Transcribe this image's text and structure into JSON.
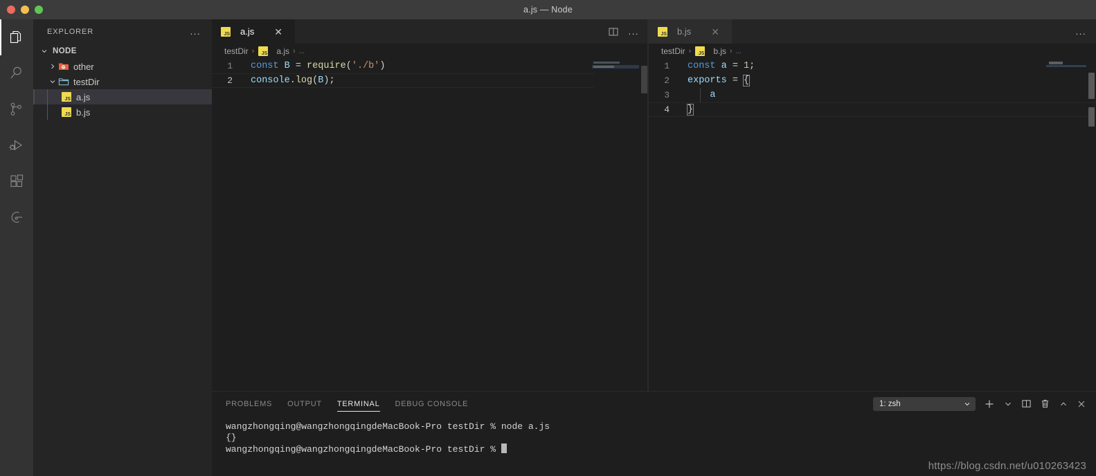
{
  "window": {
    "title": "a.js — Node",
    "traffic_lights": [
      "close",
      "minimize",
      "zoom"
    ]
  },
  "activity_bar": {
    "items": [
      {
        "name": "explorer",
        "icon": "files-icon",
        "active": true
      },
      {
        "name": "search",
        "icon": "search-icon",
        "active": false
      },
      {
        "name": "source-control",
        "icon": "source-control-icon",
        "active": false
      },
      {
        "name": "run-and-debug",
        "icon": "run-debug-icon",
        "active": false
      },
      {
        "name": "extensions",
        "icon": "extensions-icon",
        "active": false
      },
      {
        "name": "remote-explorer",
        "icon": "remote-icon",
        "active": false
      }
    ]
  },
  "sidebar": {
    "header": {
      "title": "EXPLORER",
      "more_actions": "..."
    },
    "root": {
      "label": "NODE",
      "expanded": true
    },
    "tree": [
      {
        "label": "other",
        "type": "folder",
        "icon": "folder-other-icon",
        "expanded": false,
        "depth": 1,
        "selected": false
      },
      {
        "label": "testDir",
        "type": "folder",
        "icon": "folder-open-icon",
        "expanded": true,
        "depth": 1,
        "selected": false
      },
      {
        "label": "a.js",
        "type": "file",
        "icon": "js-file-icon",
        "depth": 2,
        "selected": true
      },
      {
        "label": "b.js",
        "type": "file",
        "icon": "js-file-icon",
        "depth": 2,
        "selected": false
      }
    ]
  },
  "editor_left": {
    "tab": {
      "label": "a.js",
      "icon": "js-file-icon",
      "active": true,
      "close_icon": "close-icon"
    },
    "actions": [
      {
        "name": "split-editor",
        "icon": "split-editor-icon"
      },
      {
        "name": "more-actions",
        "icon": "ellipsis-icon",
        "label": "..."
      }
    ],
    "breadcrumbs": [
      {
        "label": "testDir",
        "icon": ""
      },
      {
        "label": "a.js",
        "icon": "js-file-icon"
      },
      {
        "label": "...",
        "icon": ""
      }
    ],
    "lines": [
      {
        "number": "1",
        "current": false,
        "tokens": [
          {
            "t": "const",
            "c": "kw"
          },
          {
            "t": " ",
            "c": "punc"
          },
          {
            "t": "B",
            "c": "var"
          },
          {
            "t": " = ",
            "c": "punc"
          },
          {
            "t": "require",
            "c": "fn"
          },
          {
            "t": "(",
            "c": "punc"
          },
          {
            "t": "'./b'",
            "c": "str"
          },
          {
            "t": ")",
            "c": "punc"
          }
        ]
      },
      {
        "number": "2",
        "current": true,
        "tokens": [
          {
            "t": "console",
            "c": "var"
          },
          {
            "t": ".",
            "c": "punc"
          },
          {
            "t": "log",
            "c": "prop"
          },
          {
            "t": "(",
            "c": "punc"
          },
          {
            "t": "B",
            "c": "var"
          },
          {
            "t": ")",
            "c": "punc"
          },
          {
            "t": ";",
            "c": "punc"
          }
        ]
      }
    ]
  },
  "editor_right": {
    "tab": {
      "label": "b.js",
      "icon": "js-file-icon",
      "active": false,
      "close_icon": "close-icon"
    },
    "actions": [
      {
        "name": "more-actions",
        "icon": "ellipsis-icon",
        "label": "..."
      }
    ],
    "breadcrumbs": [
      {
        "label": "testDir",
        "icon": ""
      },
      {
        "label": "b.js",
        "icon": "js-file-icon"
      },
      {
        "label": "...",
        "icon": ""
      }
    ],
    "lines": [
      {
        "number": "1",
        "current": false,
        "tokens": [
          {
            "t": "const",
            "c": "kw"
          },
          {
            "t": " ",
            "c": "punc"
          },
          {
            "t": "a",
            "c": "var"
          },
          {
            "t": " = ",
            "c": "punc"
          },
          {
            "t": "1",
            "c": "num"
          },
          {
            "t": ";",
            "c": "punc"
          }
        ]
      },
      {
        "number": "2",
        "current": false,
        "tokens": [
          {
            "t": "exports",
            "c": "var"
          },
          {
            "t": " = ",
            "c": "punc"
          },
          {
            "t": "{",
            "c": "brk"
          }
        ]
      },
      {
        "number": "3",
        "current": false,
        "tokens": [
          {
            "t": "    ",
            "c": "punc"
          },
          {
            "t": "a",
            "c": "var"
          }
        ]
      },
      {
        "number": "4",
        "current": true,
        "tokens": [
          {
            "t": "}",
            "c": "brk"
          }
        ]
      }
    ]
  },
  "panel": {
    "tabs": [
      {
        "label": "PROBLEMS",
        "active": false
      },
      {
        "label": "OUTPUT",
        "active": false
      },
      {
        "label": "TERMINAL",
        "active": true
      },
      {
        "label": "DEBUG CONSOLE",
        "active": false
      }
    ],
    "terminal_select": {
      "value": "1: zsh",
      "chevron": "chevron-down-icon"
    },
    "actions": [
      {
        "name": "new-terminal",
        "icon": "plus-icon"
      },
      {
        "name": "terminal-kind-chevron",
        "icon": "chevron-down-icon"
      },
      {
        "name": "split-terminal",
        "icon": "split-icon"
      },
      {
        "name": "kill-terminal",
        "icon": "trash-icon"
      },
      {
        "name": "maximize-panel",
        "icon": "chevron-up-icon"
      },
      {
        "name": "close-panel",
        "icon": "close-icon"
      }
    ],
    "terminal_lines": [
      {
        "text": "wangzhongqing@wangzhongqingdeMacBook-Pro testDir % node a.js",
        "cursor": false
      },
      {
        "text": "{}",
        "cursor": false
      },
      {
        "text": "wangzhongqing@wangzhongqingdeMacBook-Pro testDir % ",
        "cursor": true
      }
    ]
  },
  "watermark": {
    "text": "https://blog.csdn.net/u010263423"
  },
  "colors": {
    "editor_bg": "#1e1e1e",
    "sidebar_bg": "#252526",
    "activitybar_bg": "#333333",
    "titlebar_bg": "#3c3c3c",
    "keyword": "#569cd6",
    "variable": "#9cdcfe",
    "function": "#dcdcaa",
    "string": "#ce9178",
    "number": "#b5cea8",
    "selection": "#37373d",
    "js_yellow": "#f0db4f"
  }
}
